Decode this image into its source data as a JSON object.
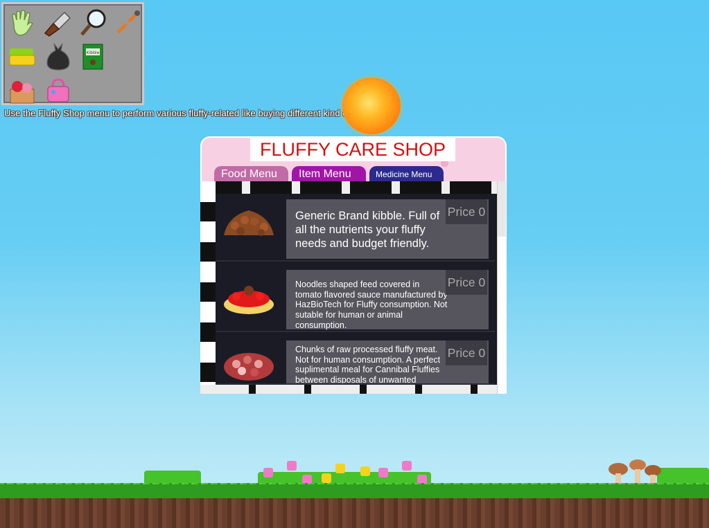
{
  "toolbox": {
    "tools": [
      "glove-icon",
      "cleaver-icon",
      "magnifier-icon",
      "tools-icon",
      "sponge-icon",
      "trash-bag-icon",
      "kibble-box-icon",
      "toy-box-icon",
      "purse-icon"
    ]
  },
  "hint": "Use the Fluffy Shop menu to perform various fluffy-related like buying different kind of item!",
  "shop": {
    "title": "FLUFFY CARE SHOP",
    "tabs": [
      {
        "label": "Food Menu",
        "color": "#c26aa6"
      },
      {
        "label": "Item Menu",
        "color": "#a214a8"
      },
      {
        "label": "Medicine Menu",
        "color": "#2c2a8e"
      }
    ],
    "items": [
      {
        "icon": "kibble-pile-icon",
        "description": "Generic Brand kibble. Full of all the nutrients your fluffy needs and budget friendly.",
        "price": "Price 0"
      },
      {
        "icon": "spaghetti-icon",
        "description": "Noodles shaped feed covered in tomato flavored sauce manufactured by HazBioTech for Fluffy consumption. Not sutable for human or animal consumption.",
        "price": "Price 0"
      },
      {
        "icon": "raw-meat-icon",
        "description": "Chunks of raw processed fluffy meat. Not for human consumption. A perfect suplimental meal for Cannibal Fluffies between disposals of unwanted foals/corpses/unwanted stock during",
        "price": "Price 0"
      }
    ]
  }
}
